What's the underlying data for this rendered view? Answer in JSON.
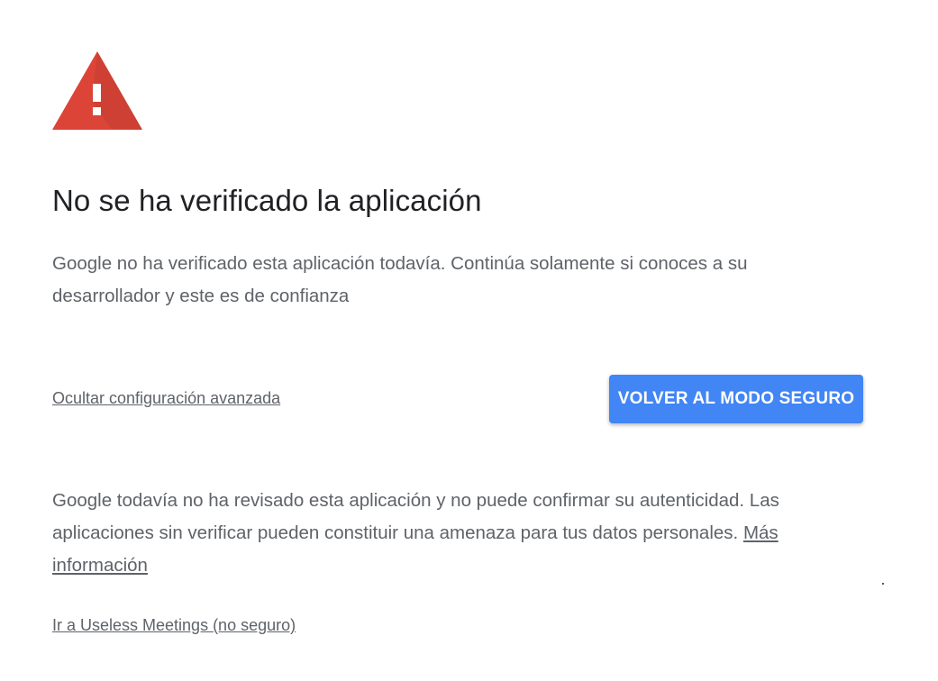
{
  "icon": "warning-triangle-icon",
  "colors": {
    "warning_red": "#db4437",
    "button_blue": "#4285f4",
    "text_gray": "#5f6368",
    "title_dark": "#202124"
  },
  "title": "No se ha verificado la aplicación",
  "intro_text": "Google no ha verificado esta aplicación todavía. Continúa solamente si conoces a su desarrollador y este es de confianza",
  "advanced_toggle_label": "Ocultar configuración avanzada",
  "back_button_label": "VOLVER AL MODO SEGURO",
  "details_text": "Google todavía no ha revisado esta aplicación y no puede confirmar su autenticidad. Las aplicaciones sin verificar pueden constituir una amenaza para tus datos personales.",
  "learn_more_label": "Más información",
  "proceed_link_label": "Ir a Useless Meetings (no seguro)"
}
